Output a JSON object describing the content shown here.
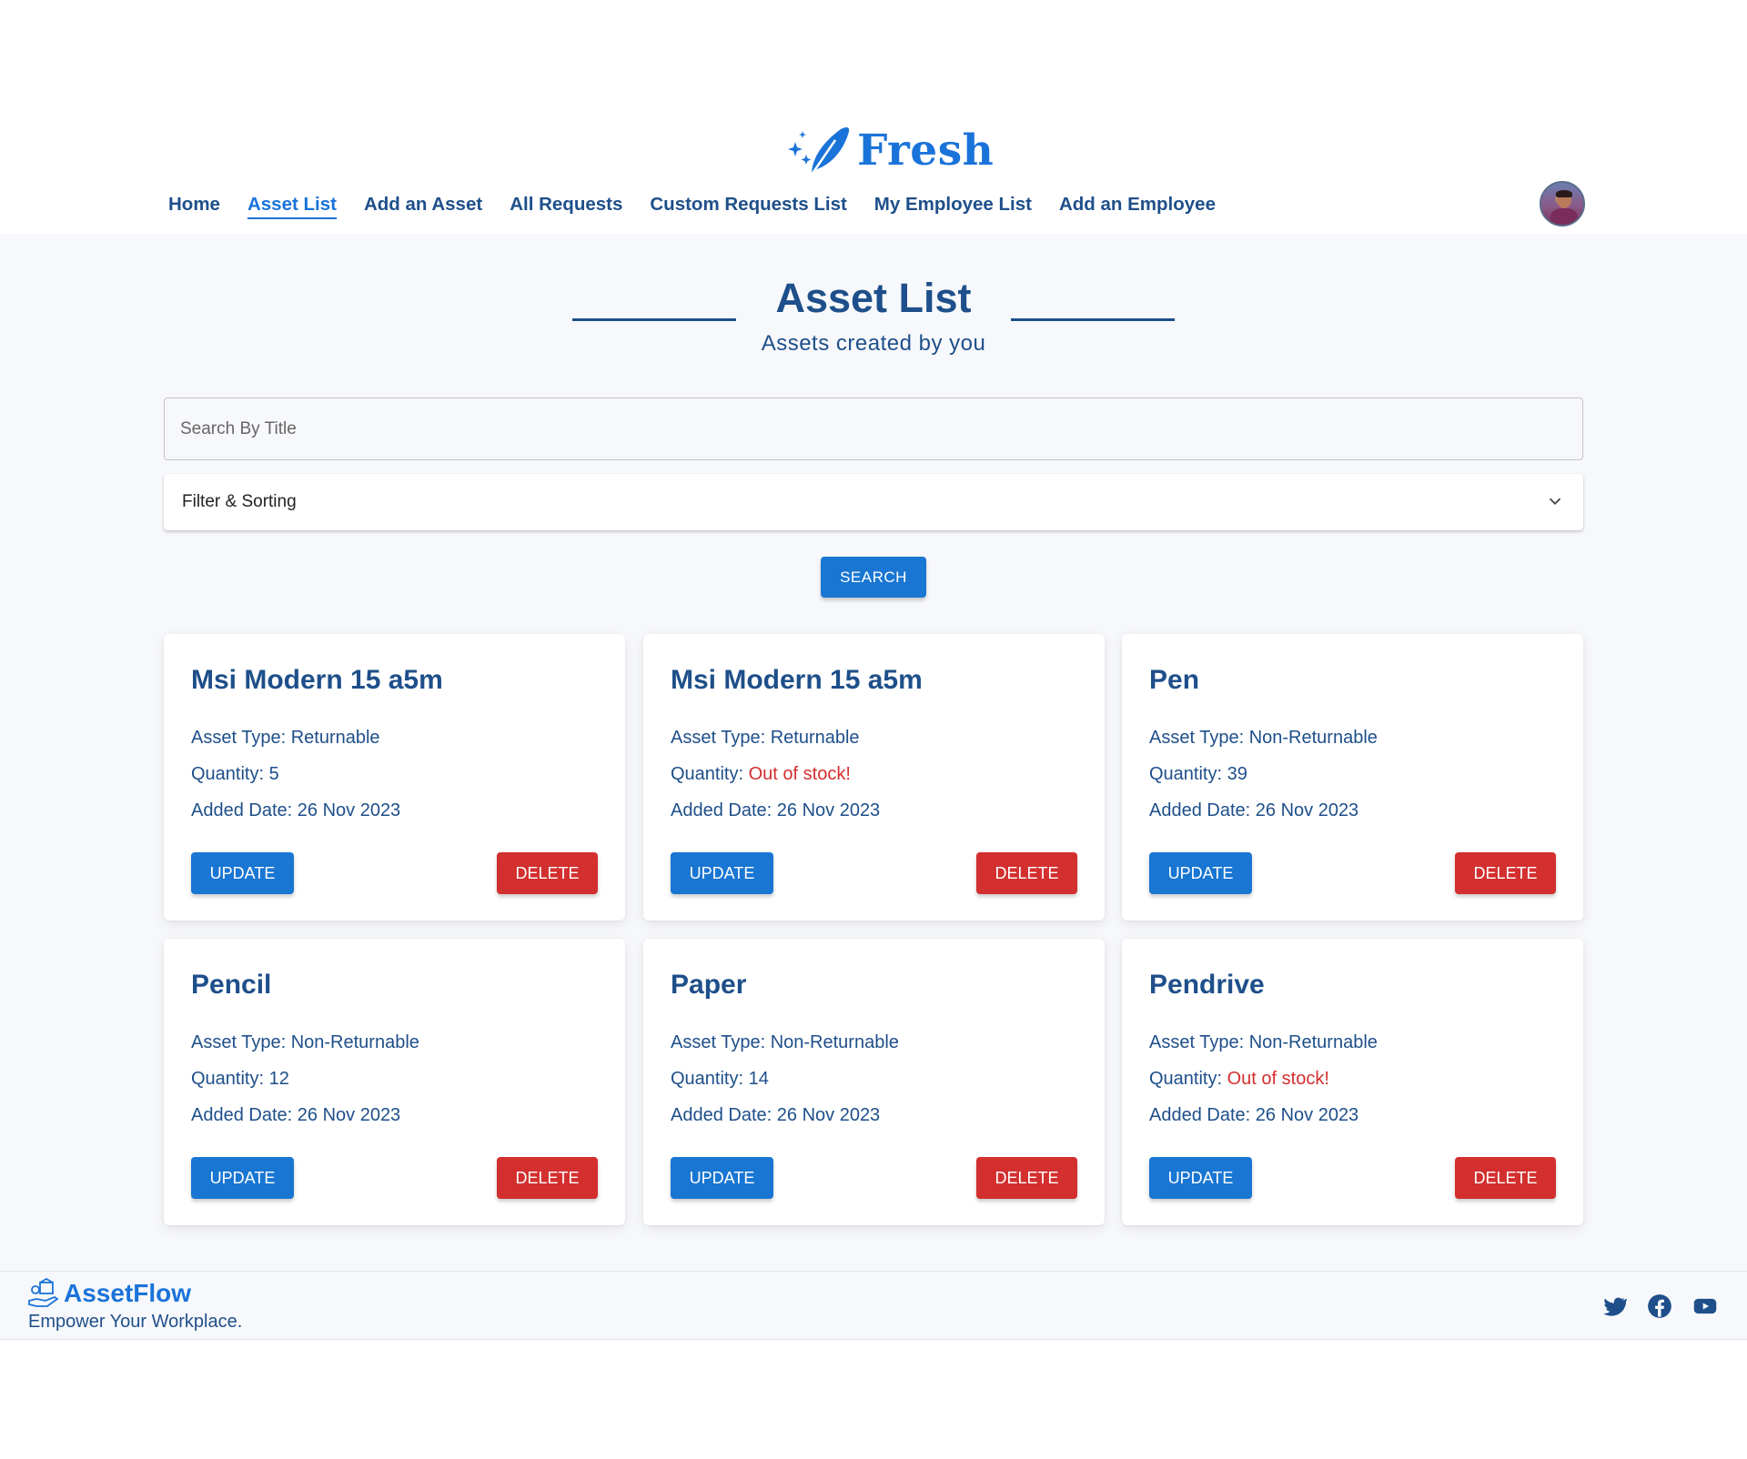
{
  "brand": {
    "name": "Fresh",
    "accent": "#1a73d9",
    "text_color": "#1e4f8a"
  },
  "nav": {
    "items": [
      {
        "label": "Home",
        "active": false
      },
      {
        "label": "Asset List",
        "active": true
      },
      {
        "label": "Add an Asset",
        "active": false
      },
      {
        "label": "All Requests",
        "active": false
      },
      {
        "label": "Custom Requests List",
        "active": false
      },
      {
        "label": "My Employee List",
        "active": false
      },
      {
        "label": "Add an Employee",
        "active": false
      }
    ],
    "avatar_icon": "user-avatar"
  },
  "page": {
    "title": "Asset List",
    "subtitle": "Assets created by you"
  },
  "search": {
    "placeholder": "Search By Title",
    "value": ""
  },
  "filter": {
    "label": "Filter & Sorting",
    "icon": "chevron-down-icon"
  },
  "search_button": {
    "label": "SEARCH"
  },
  "colors": {
    "primary": "#1976d2",
    "danger": "#d32f2f",
    "out_of_stock": "#d32f2f"
  },
  "assets": [
    {
      "title": "Msi Modern 15 a5m",
      "type_label": "Asset Type:",
      "type": "Returnable",
      "quantity_label": "Quantity:",
      "quantity": "5",
      "out_of_stock": false,
      "date_label": "Added Date:",
      "date": "26 Nov 2023",
      "update_label": "UPDATE",
      "delete_label": "DELETE"
    },
    {
      "title": "Msi Modern 15 a5m",
      "type_label": "Asset Type:",
      "type": "Returnable",
      "quantity_label": "Quantity:",
      "quantity": "Out of stock!",
      "out_of_stock": true,
      "date_label": "Added Date:",
      "date": "26 Nov 2023",
      "update_label": "UPDATE",
      "delete_label": "DELETE"
    },
    {
      "title": "Pen",
      "type_label": "Asset Type:",
      "type": "Non-Returnable",
      "quantity_label": "Quantity:",
      "quantity": "39",
      "out_of_stock": false,
      "date_label": "Added Date:",
      "date": "26 Nov 2023",
      "update_label": "UPDATE",
      "delete_label": "DELETE"
    },
    {
      "title": "Pencil",
      "type_label": "Asset Type:",
      "type": "Non-Returnable",
      "quantity_label": "Quantity:",
      "quantity": "12",
      "out_of_stock": false,
      "date_label": "Added Date:",
      "date": "26 Nov 2023",
      "update_label": "UPDATE",
      "delete_label": "DELETE"
    },
    {
      "title": "Paper",
      "type_label": "Asset Type:",
      "type": "Non-Returnable",
      "quantity_label": "Quantity:",
      "quantity": "14",
      "out_of_stock": false,
      "date_label": "Added Date:",
      "date": "26 Nov 2023",
      "update_label": "UPDATE",
      "delete_label": "DELETE"
    },
    {
      "title": "Pendrive",
      "type_label": "Asset Type:",
      "type": "Non-Returnable",
      "quantity_label": "Quantity:",
      "quantity": "Out of stock!",
      "out_of_stock": true,
      "date_label": "Added Date:",
      "date": "26 Nov 2023",
      "update_label": "UPDATE",
      "delete_label": "DELETE"
    }
  ],
  "footer": {
    "brand": "AssetFlow",
    "tagline": "Empower Your Workplace.",
    "social_icons": [
      "twitter-icon",
      "facebook-icon",
      "youtube-icon"
    ]
  }
}
